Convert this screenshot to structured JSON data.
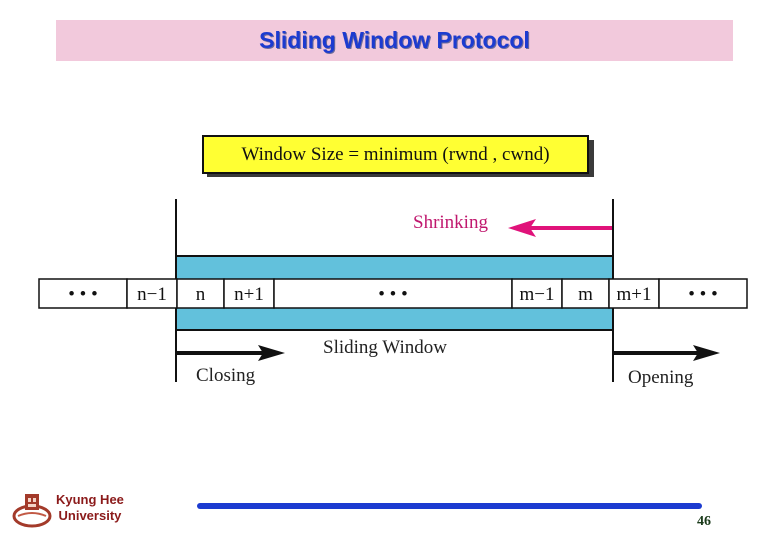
{
  "slide": {
    "title": "Sliding Window Protocol",
    "formula": "Window Size = minimum (rwnd , cwnd)",
    "page_number": "46"
  },
  "diagram": {
    "cells": [
      {
        "label": "• • •",
        "in_window": false
      },
      {
        "label": "n−1",
        "in_window": false
      },
      {
        "label": "n",
        "in_window": true
      },
      {
        "label": "n+1",
        "in_window": true
      },
      {
        "label": "•   •   •",
        "in_window": true
      },
      {
        "label": "m−1",
        "in_window": true
      },
      {
        "label": "m",
        "in_window": true
      },
      {
        "label": "m+1",
        "in_window": false
      },
      {
        "label": "• • •",
        "in_window": false
      }
    ],
    "window_label": "Sliding Window",
    "shrinking_label": "Shrinking",
    "closing_label": "Closing",
    "opening_label": "Opening",
    "colors": {
      "window_fill": "#62c1dc",
      "shrink_arrow": "#e0127a",
      "formula_fill": "#ffff33"
    }
  },
  "footer": {
    "university_line1": "Kyung Hee",
    "university_line2": "University",
    "logo_icon": "university-crest-icon"
  }
}
